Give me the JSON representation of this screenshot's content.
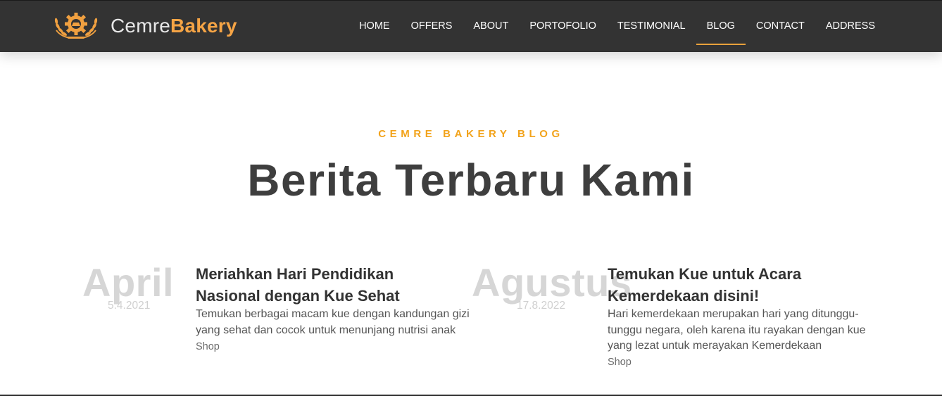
{
  "navbar": {
    "brand": {
      "text_light": "Cemre",
      "text_bold": "Bakery",
      "logo_icon": "bakery-gear-wheat-logo",
      "accent_color": "#f5a445"
    },
    "menu": [
      {
        "label": "HOME",
        "active": false
      },
      {
        "label": "OFFERS",
        "active": false
      },
      {
        "label": "ABOUT",
        "active": false
      },
      {
        "label": "PORTOFOLIO",
        "active": false
      },
      {
        "label": "TESTIMONIAL",
        "active": false
      },
      {
        "label": "BLOG",
        "active": true
      },
      {
        "label": "CONTACT",
        "active": false
      },
      {
        "label": "ADDRESS",
        "active": false
      }
    ],
    "background_color": "#333333"
  },
  "blog_section": {
    "eyebrow": "CEMRE BAKERY BLOG",
    "title": "Berita Terbaru Kami",
    "eyebrow_color": "#f2a31b",
    "posts": [
      {
        "month": "April",
        "date": "5.4.2021",
        "title": "Meriahkan Hari Pendidikan Nasional dengan Kue Sehat",
        "excerpt": "Temukan berbagai macam kue dengan kandungan gizi yang sehat dan cocok untuk menunjang nutrisi anak",
        "link": "Shop"
      },
      {
        "month": "Agustus",
        "date": "17.8.2022",
        "title": "Temukan Kue untuk Acara Kemerdekaan disini!",
        "excerpt": "Hari kemerdekaan merupakan hari yang ditunggu-tunggu negara, oleh karena itu rayakan dengan kue yang lezat untuk merayakan Kemerdekaan",
        "link": "Shop"
      }
    ]
  }
}
